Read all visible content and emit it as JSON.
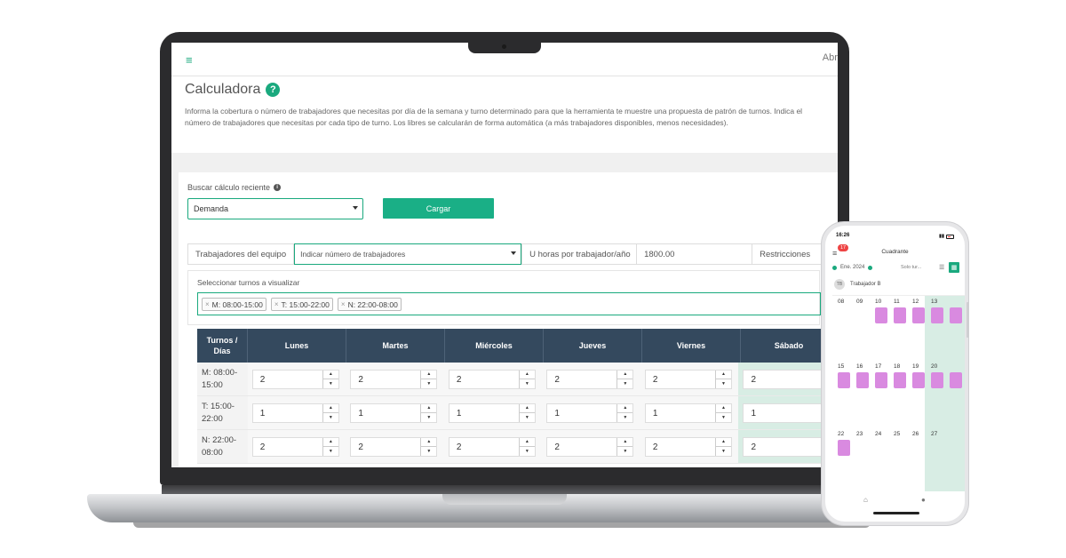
{
  "app": {
    "menu_icon": "hamburger-icon",
    "open_label": "Abrir"
  },
  "header": {
    "title": "Calculadora",
    "help_icon": "?",
    "description": "Informa la cobertura o número de trabajadores que necesitas por día de la semana y turno determinado para que la herramienta te muestre una propuesta de patrón de turnos. Indica el número de trabajadores que necesitas por cada tipo de turno. Los libres se calcularán de forma automática (a más trabajadores disponibles, menos necesidades)."
  },
  "search": {
    "label": "Buscar cálculo reciente",
    "info_icon": "i",
    "selected": "Demanda",
    "load_button": "Cargar"
  },
  "params": {
    "team_label": "Trabajadores del equipo",
    "team_select": "Indicar número de trabajadores",
    "hours_label": "U horas por trabajador/año",
    "hours_value": "1800.00",
    "restrictions_label": "Restricciones"
  },
  "turns": {
    "label": "Seleccionar turnos a visualizar",
    "chips": [
      "M: 08:00-15:00",
      "T: 15:00-22:00",
      "N: 22:00-08:00"
    ]
  },
  "grid": {
    "corner": "Turnos / Días",
    "days": [
      "Lunes",
      "Martes",
      "Miércoles",
      "Jueves",
      "Viernes",
      "Sábado"
    ],
    "rows": [
      {
        "label": "M: 08:00-15:00",
        "values": [
          "2",
          "2",
          "2",
          "2",
          "2",
          "2"
        ]
      },
      {
        "label": "T: 15:00-22:00",
        "values": [
          "1",
          "1",
          "1",
          "1",
          "1",
          "1"
        ]
      },
      {
        "label": "N: 22:00-08:00",
        "values": [
          "2",
          "2",
          "2",
          "2",
          "2",
          "2"
        ]
      }
    ]
  },
  "phone": {
    "time": "16:26",
    "badge": "17",
    "title": "Cuadrante",
    "month": "Ene. 2024",
    "filter": "Solo tur...",
    "worker_initials": "TB",
    "worker": "Trabajador B",
    "weeks": [
      [
        "08",
        "09",
        "10",
        "11",
        "12",
        "13"
      ],
      [
        "15",
        "16",
        "17",
        "18",
        "19",
        "20"
      ],
      [
        "22",
        "23",
        "24",
        "25",
        "26",
        "27"
      ]
    ]
  },
  "colors": {
    "accent": "#1aa97e",
    "header_dark": "#34495e",
    "shift_pink": "#d98ae0",
    "weekend_green": "#d8ede4"
  }
}
